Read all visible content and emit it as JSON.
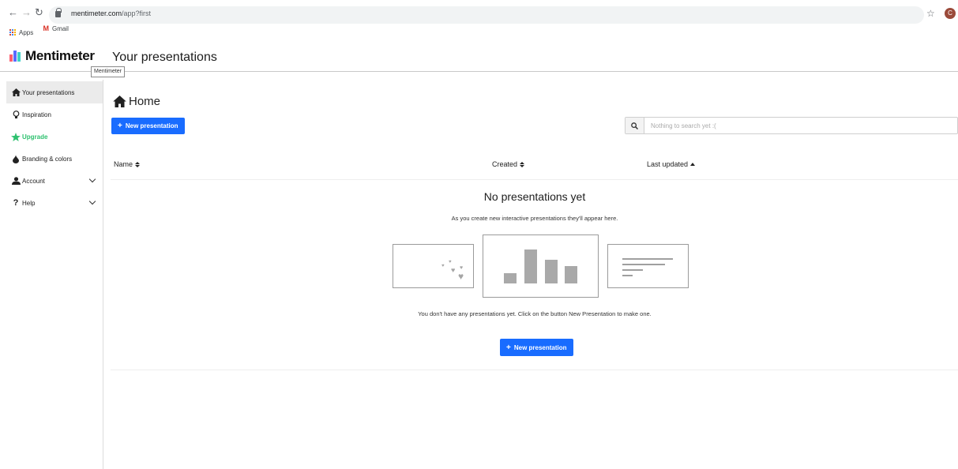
{
  "browser": {
    "url_host": "mentimeter.com",
    "url_path": "/app?first",
    "profile_initial": "C",
    "bookmarks": [
      {
        "label": "Apps"
      },
      {
        "label": "Gmail"
      }
    ]
  },
  "header": {
    "logo_text": "Mentimeter",
    "page_title": "Your presentations",
    "tooltip": "Mentimeter",
    "logo_colors": [
      "#ff5d6e",
      "#5a6bff",
      "#3ed0c8"
    ]
  },
  "sidebar": {
    "items": [
      {
        "label": "Your presentations",
        "icon": "home-icon"
      },
      {
        "label": "Inspiration",
        "icon": "lightbulb-icon"
      },
      {
        "label": "Upgrade",
        "icon": "star-icon"
      },
      {
        "label": "Branding & colors",
        "icon": "droplet-icon"
      },
      {
        "label": "Account",
        "icon": "user-icon"
      },
      {
        "label": "Help",
        "icon": "question-icon"
      }
    ]
  },
  "main": {
    "heading": "Home",
    "new_button_label": "New presentation",
    "search_placeholder": "Nothing to search yet :(",
    "columns": {
      "name": "Name",
      "created": "Created",
      "last_updated": "Last updated"
    },
    "empty": {
      "title": "No presentations yet",
      "subtitle": "As you create new interactive presentations they'll appear here.",
      "message": "You don't have any presentations yet. Click on the button New Presentation to make one.",
      "button_label": "New presentation"
    },
    "accent_color": "#196cff",
    "upgrade_color": "#2ec16f"
  }
}
